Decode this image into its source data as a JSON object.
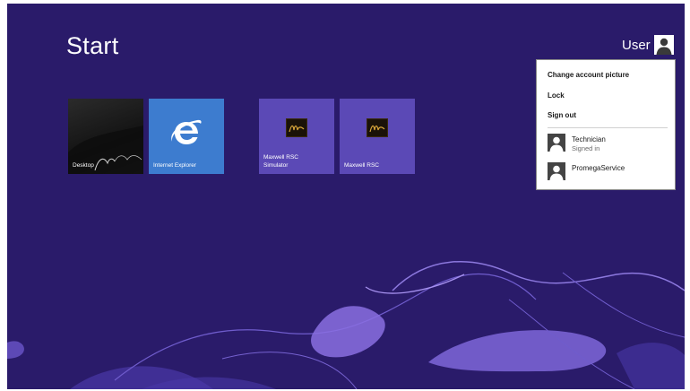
{
  "start": {
    "title": "Start"
  },
  "user": {
    "name": "User",
    "icon": "person-icon"
  },
  "tiles": [
    {
      "label": "Desktop",
      "icon": "desktop-wallpaper",
      "color": "#1a1a1a"
    },
    {
      "label": "Internet Explorer",
      "icon": "ie-logo-icon",
      "color": "#3d7ccf"
    },
    {
      "label": "Maxwell RSC\nSimulator",
      "icon": "maxwell-logo-icon",
      "color": "#5b49b6"
    },
    {
      "label": "Maxwell RSC",
      "icon": "maxwell-logo-icon",
      "color": "#5b49b6"
    }
  ],
  "account_menu": {
    "items": [
      {
        "label": "Change account picture"
      },
      {
        "label": "Lock"
      },
      {
        "label": "Sign out"
      }
    ],
    "accounts": [
      {
        "name": "Technician",
        "status": "Signed in"
      },
      {
        "name": "PromegaService",
        "status": ""
      }
    ]
  },
  "colors": {
    "background": "#2a1b6a",
    "accent": "#5b49b6",
    "ie_tile": "#3d7ccf"
  }
}
